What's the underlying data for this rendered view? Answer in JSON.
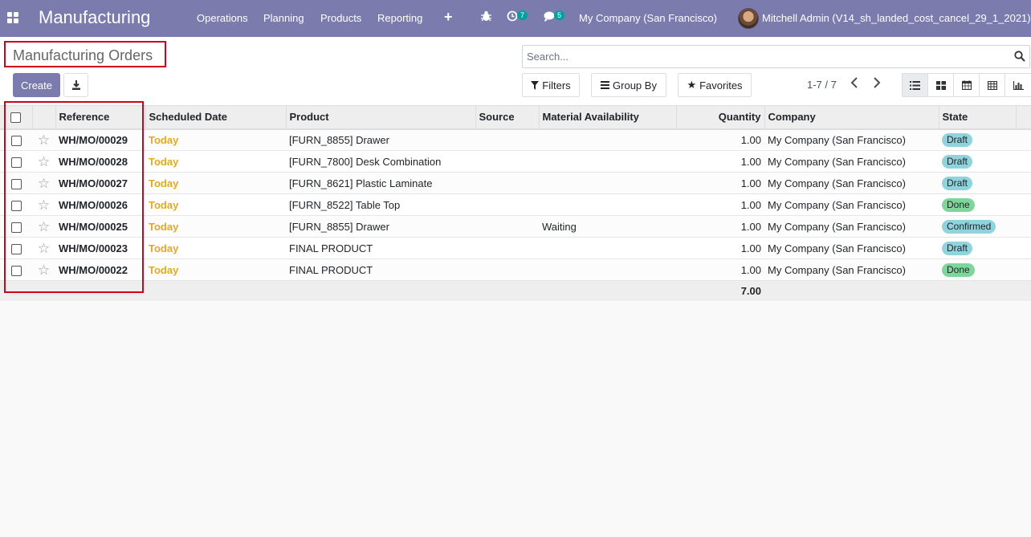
{
  "navbar": {
    "app_name": "Manufacturing",
    "menu": [
      "Operations",
      "Planning",
      "Products",
      "Reporting"
    ],
    "activity_count": "7",
    "message_count": "5",
    "company": "My Company (San Francisco)",
    "user": "Mitchell Admin (V14_sh_landed_cost_cancel_29_1_2021)"
  },
  "control": {
    "title": "Manufacturing Orders",
    "create_label": "Create",
    "search_placeholder": "Search...",
    "filters_label": "Filters",
    "group_by_label": "Group By",
    "favorites_label": "Favorites",
    "pager": "1-7 / 7"
  },
  "table": {
    "headers": {
      "reference": "Reference",
      "scheduled_date": "Scheduled Date",
      "product": "Product",
      "source": "Source",
      "material_availability": "Material Availability",
      "quantity": "Quantity",
      "company": "Company",
      "state": "State"
    },
    "rows": [
      {
        "ref": "WH/MO/00029",
        "date": "Today",
        "product": "[FURN_8855] Drawer",
        "source": "",
        "availability": "",
        "qty": "1.00",
        "company": "My Company (San Francisco)",
        "state": "Draft"
      },
      {
        "ref": "WH/MO/00028",
        "date": "Today",
        "product": "[FURN_7800] Desk Combination",
        "source": "",
        "availability": "",
        "qty": "1.00",
        "company": "My Company (San Francisco)",
        "state": "Draft"
      },
      {
        "ref": "WH/MO/00027",
        "date": "Today",
        "product": "[FURN_8621] Plastic Laminate",
        "source": "",
        "availability": "",
        "qty": "1.00",
        "company": "My Company (San Francisco)",
        "state": "Draft"
      },
      {
        "ref": "WH/MO/00026",
        "date": "Today",
        "product": "[FURN_8522] Table Top",
        "source": "",
        "availability": "",
        "qty": "1.00",
        "company": "My Company (San Francisco)",
        "state": "Done"
      },
      {
        "ref": "WH/MO/00025",
        "date": "Today",
        "product": "[FURN_8855] Drawer",
        "source": "",
        "availability": "Waiting",
        "qty": "1.00",
        "company": "My Company (San Francisco)",
        "state": "Confirmed"
      },
      {
        "ref": "WH/MO/00023",
        "date": "Today",
        "product": "FINAL PRODUCT",
        "source": "",
        "availability": "",
        "qty": "1.00",
        "company": "My Company (San Francisco)",
        "state": "Draft"
      },
      {
        "ref": "WH/MO/00022",
        "date": "Today",
        "product": "FINAL PRODUCT",
        "source": "",
        "availability": "",
        "qty": "1.00",
        "company": "My Company (San Francisco)",
        "state": "Done"
      }
    ],
    "total_quantity": "7.00"
  },
  "state_colors": {
    "Draft": "#8fd4dc",
    "Done": "#7fd69a",
    "Confirmed": "#8fd4dc"
  },
  "colors": {
    "brand": "#7c7bad",
    "today": "#e5a822",
    "highlight": "#d0021b"
  }
}
